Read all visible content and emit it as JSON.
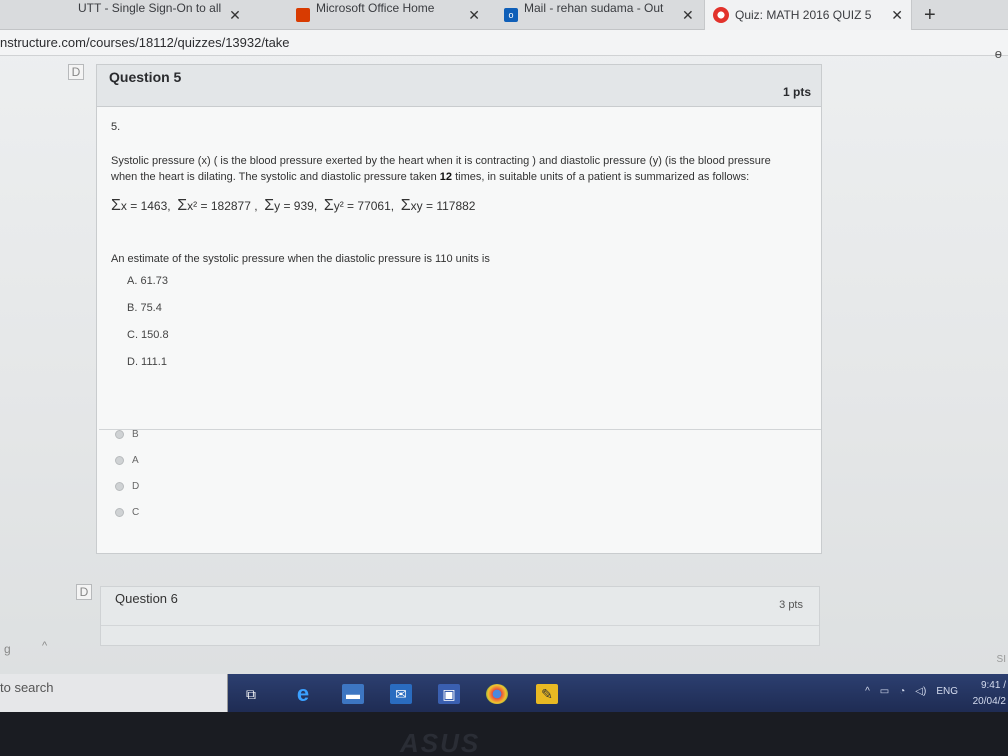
{
  "browser": {
    "tabs": [
      {
        "label": "UTT - Single Sign-On to all",
        "close": "✕"
      },
      {
        "label": "Microsoft Office Home",
        "close": "✕"
      },
      {
        "label": "Mail - rehan sudama - Out",
        "close": "✕"
      },
      {
        "label": "Quiz: MATH 2016 QUIZ 5",
        "close": "✕",
        "active": true
      }
    ],
    "new_tab": "+",
    "url": "nstructure.com/courses/18112/quizzes/13932/take",
    "address_end_glyph": "ɵ"
  },
  "question5": {
    "title": "Question 5",
    "points": "1 pts",
    "number": "5.",
    "text_line1": "Systolic pressure  (x) ( is the blood pressure exerted by the heart when it is contracting ) and diastolic pressure (y) (is the blood pressure",
    "text_line2_a": "when the heart is dilating. The systolic and  diastolic pressure taken ",
    "text_line2_bold": "12",
    "text_line2_b": " times, in suitable units of a patient is summarized as follows:",
    "sums": [
      {
        "sigma": "Σ",
        "expr": "x = 1463,"
      },
      {
        "sigma": "Σ",
        "expr": "x² = 182877 ,"
      },
      {
        "sigma": "Σ",
        "expr": "y = 939,"
      },
      {
        "sigma": "Σ",
        "expr": "y² = 77061,"
      },
      {
        "sigma": "Σ",
        "expr": "xy = 117882"
      }
    ],
    "prompt": "An estimate of the systolic pressure when the diastolic pressure is 110 units is",
    "choices": [
      "A.  61.73",
      "B.  75.4",
      "C.  150.8",
      "D.  111.1"
    ],
    "answer_options": [
      "B",
      "A",
      "D",
      "C"
    ]
  },
  "question6": {
    "title": "Question 6",
    "points": "3 pts"
  },
  "flags": {
    "q5": "D",
    "q6": "D"
  },
  "side": {
    "left": "g",
    "chevron": "^",
    "right": "SI"
  },
  "taskbar": {
    "search_text": "to search",
    "tray_lang": "ENG",
    "time": "9:41 /",
    "date": "20/04/2"
  },
  "bezel": {
    "logo": "ASUS"
  }
}
